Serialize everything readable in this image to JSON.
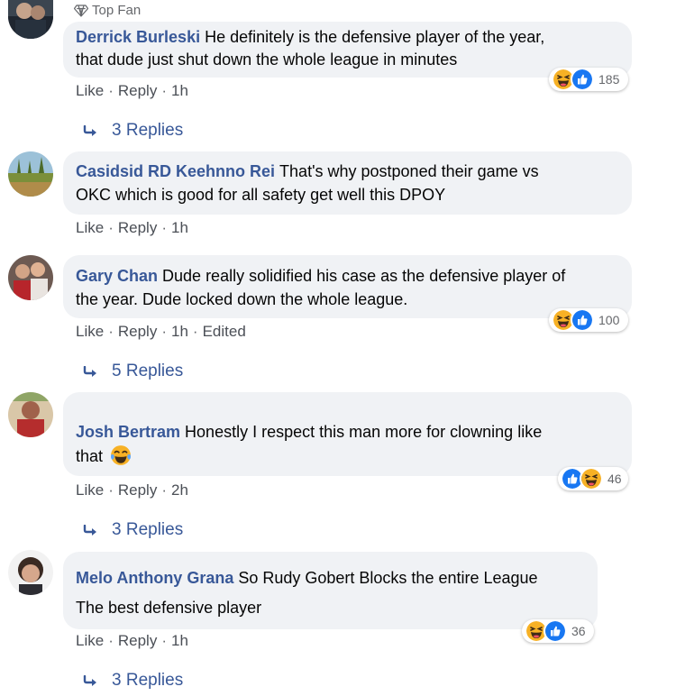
{
  "badge": {
    "label": "Top Fan"
  },
  "actions": {
    "like": "Like",
    "reply": "Reply",
    "sep": "·"
  },
  "comments": [
    {
      "author": "Derrick Burleski",
      "text_line1": "He definitely is the defensive player of the year,",
      "text_line2": "that dude just shut down the whole league in minutes",
      "time": "1h",
      "reaction_count": "185",
      "replies": "3 Replies",
      "top_fan": true
    },
    {
      "author": "Casidsid RD Keehnno Rei",
      "text_line1": "That's why postponed their game vs",
      "text_line2": "OKC which is good for all safety get well this DPOY",
      "time": "1h",
      "replies": "",
      "top_fan": false
    },
    {
      "author": "Gary Chan",
      "text_line1": "Dude really solidified his case as the defensive player of",
      "text_line2": "the year. Dude locked down the whole league.",
      "time": "1h",
      "edited": "Edited",
      "reaction_count": "100",
      "replies": "5 Replies",
      "top_fan": false
    },
    {
      "author": "Josh Bertram",
      "text_line1": "Honestly I respect this man more for clowning like",
      "text_line2": "that",
      "time": "2h",
      "reaction_count": "46",
      "replies": "3 Replies",
      "top_fan": true
    },
    {
      "author": "Melo Anthony Grana",
      "text_line1": "So Rudy Gobert Blocks the entire League",
      "text_line2": "The best defensive player",
      "time": "1h",
      "reaction_count": "36",
      "replies": "3 Replies",
      "top_fan": false
    }
  ],
  "colors": {
    "author": "#385898",
    "bubble": "#f0f2f5",
    "meta": "#65676b",
    "like_blue": "#1877f2",
    "haha_yellow": "#f7b125"
  },
  "icons": {
    "badge": "diamond-badge-icon",
    "reply_arrow": "reply-arrow-icon",
    "like": "like-reaction-icon",
    "haha": "haha-reaction-icon"
  }
}
